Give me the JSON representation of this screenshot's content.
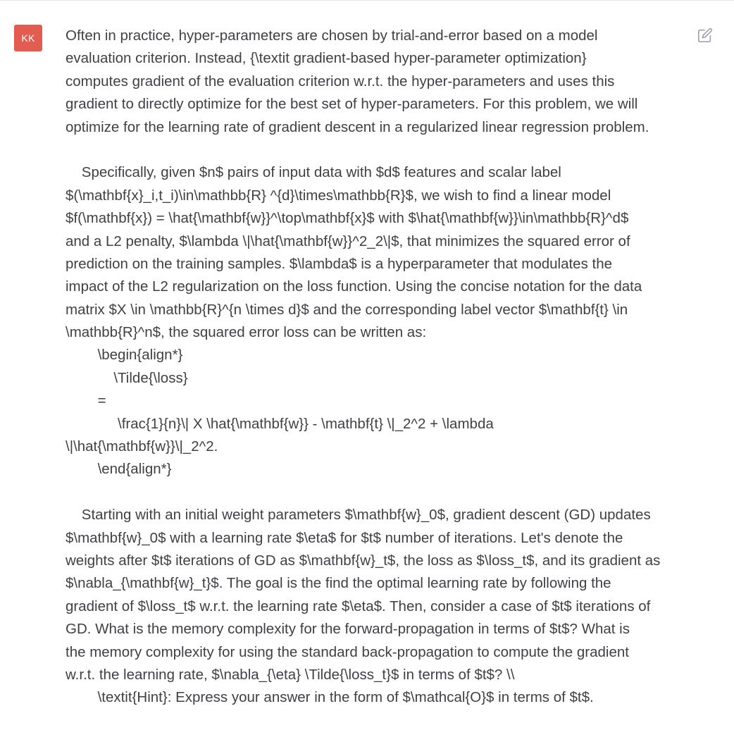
{
  "colors": {
    "avatar_bg": "#e25c4f",
    "avatar_fg": "#ffffff",
    "text": "#3f3f46",
    "icon": "#9ca3af"
  },
  "user": {
    "initials": "KK"
  },
  "edit_icon": "edit-pencil-square-icon",
  "message": {
    "lines": [
      "Often in practice, hyper-parameters are chosen by trial-and-error based on a model",
      "evaluation criterion. Instead, {\\textit gradient-based hyper-parameter optimization}",
      "computes gradient of the evaluation criterion w.r.t. the hyper-parameters and uses this",
      "gradient to directly optimize for the best set of hyper-parameters. For this problem, we will",
      "optimize for the learning rate of gradient descent in a regularized linear regression problem.",
      "",
      "    Specifically, given $n$ pairs of input data with $d$ features and scalar label",
      "$(\\mathbf{x}_i,t_i)\\in\\mathbb{R} ^{d}\\times\\mathbb{R}$, we wish to find a linear model",
      "$f(\\mathbf{x}) = \\hat{\\mathbf{w}}^\\top\\mathbf{x}$ with $\\hat{\\mathbf{w}}\\in\\mathbb{R}^d$",
      "and a L2 penalty, $\\lambda \\|\\hat{\\mathbf{w}}^2_2\\|$, that minimizes the squared error of",
      "prediction on the training samples. $\\lambda$ is a hyperparameter that modulates the",
      "impact of the L2 regularization on the loss function. Using the concise notation for the data",
      "matrix $X \\in \\mathbb{R}^{n \\times d}$ and the corresponding label vector $\\mathbf{t} \\in",
      "\\mathbb{R}^n$, the squared error loss can be written as:",
      "        \\begin{align*}",
      "            \\Tilde{\\loss}",
      "        =",
      "             \\frac{1}{n}\\| X \\hat{\\mathbf{w}} - \\mathbf{t} \\|_2^2 + \\lambda",
      "\\|\\hat{\\mathbf{w}}\\|_2^2.",
      "        \\end{align*}",
      "",
      "    Starting with an initial weight parameters $\\mathbf{w}_0$, gradient descent (GD) updates",
      "$\\mathbf{w}_0$ with a learning rate $\\eta$ for $t$ number of iterations. Let's denote the",
      "weights after $t$ iterations of GD as $\\mathbf{w}_t$, the loss as $\\loss_t$, and its gradient as",
      "$\\nabla_{\\mathbf{w}_t}$. The goal is the find the optimal learning rate by following the",
      "gradient of $\\loss_t$ w.r.t. the learning rate $\\eta$. Then, consider a case of $t$ iterations of",
      "GD. What is the memory complexity for the forward-propagation in terms of $t$? What is",
      "the memory complexity for using the standard back-propagation to compute the gradient",
      "w.r.t. the learning rate, $\\nabla_{\\eta} \\Tilde{\\loss_t}$ in terms of $t$? \\\\",
      "        \\textit{Hint}: Express your answer in the form of $\\mathcal{O}$ in terms of $t$."
    ]
  }
}
